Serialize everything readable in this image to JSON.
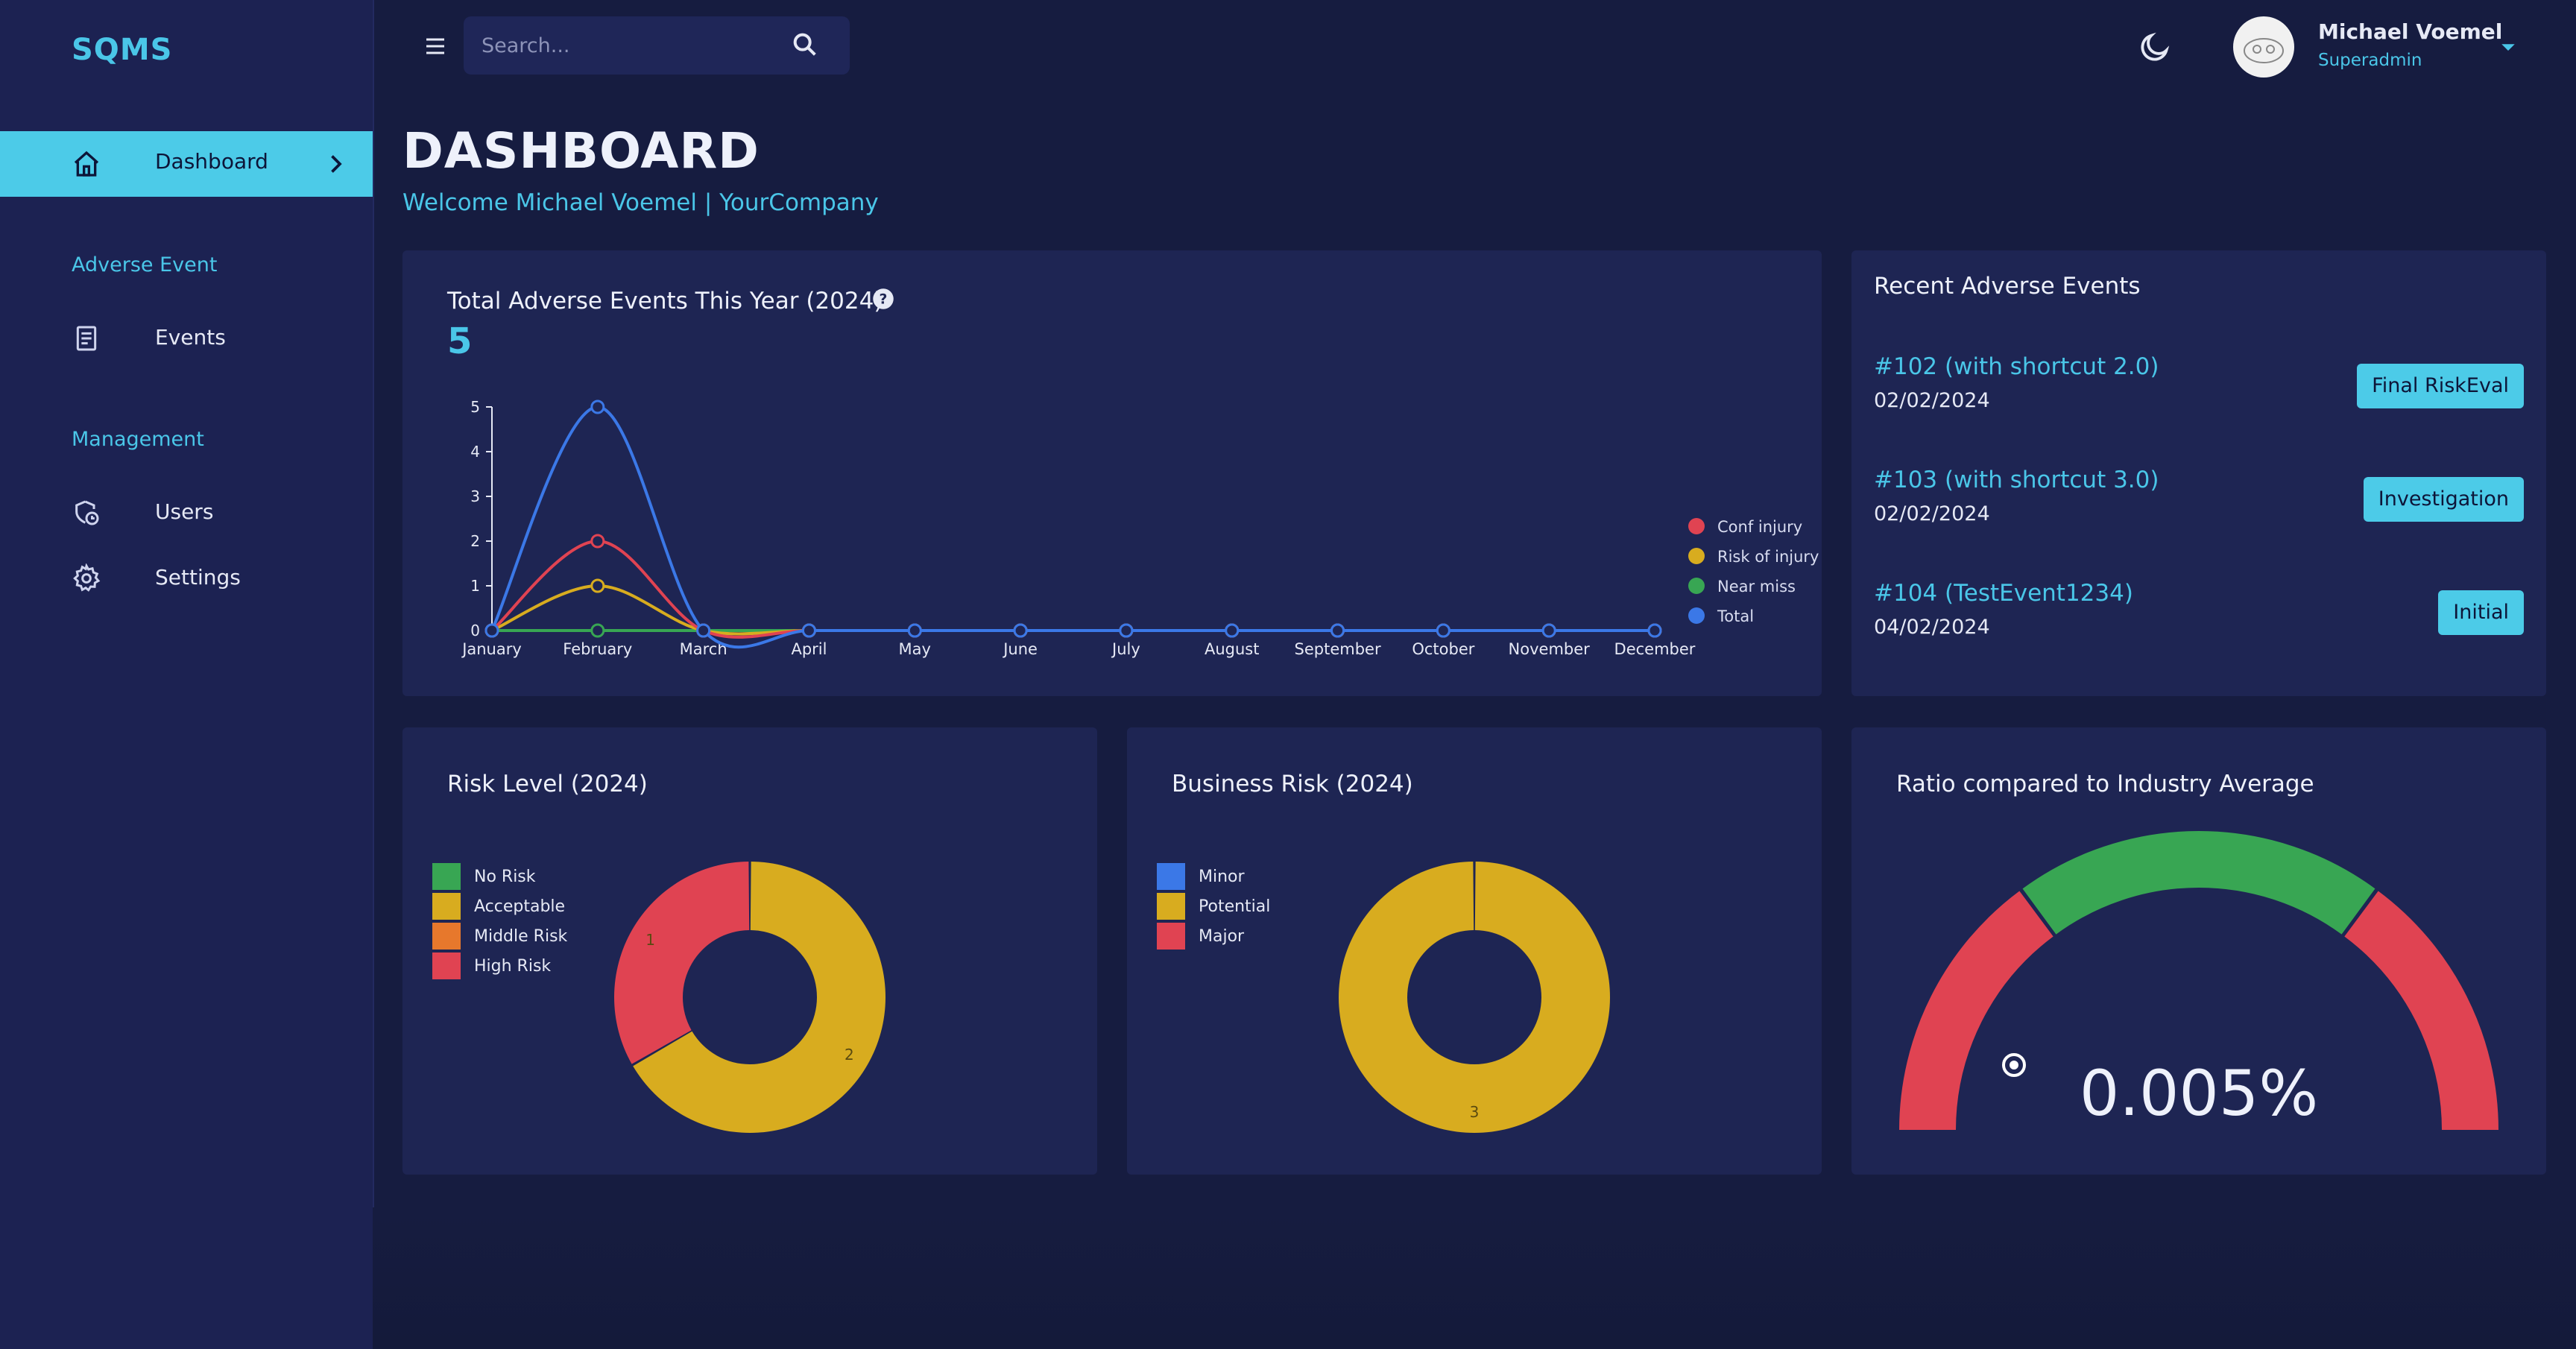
{
  "app": {
    "brand": "SQMS"
  },
  "sidebar": {
    "active_item": {
      "label": "Dashboard",
      "icon": "home-icon"
    },
    "sections": [
      {
        "title": "Adverse Event",
        "items": [
          {
            "label": "Events",
            "icon": "document-icon"
          }
        ]
      },
      {
        "title": "Management",
        "items": [
          {
            "label": "Users",
            "icon": "users-shield-icon"
          },
          {
            "label": "Settings",
            "icon": "gear-icon"
          }
        ]
      }
    ]
  },
  "topbar": {
    "search_placeholder": "Search...",
    "user": {
      "name": "Michael Voemel",
      "role": "Superadmin"
    }
  },
  "page": {
    "title": "DASHBOARD",
    "welcome": "Welcome Michael Voemel | YourCompany"
  },
  "total_events": {
    "title": "Total Adverse Events This Year (2024)",
    "value": "5"
  },
  "recent_events": {
    "title": "Recent Adverse Events",
    "items": [
      {
        "id": "#102 (with shortcut 2.0)",
        "date": "02/02/2024",
        "status": "Final RiskEval"
      },
      {
        "id": "#103 (with shortcut 3.0)",
        "date": "02/02/2024",
        "status": "Investigation"
      },
      {
        "id": "#104 (TestEvent1234)",
        "date": "04/02/2024",
        "status": "Initial"
      }
    ]
  },
  "risk_level": {
    "title": "Risk Level (2024)"
  },
  "business_risk": {
    "title": "Business Risk (2024)"
  },
  "gauge": {
    "title": "Ratio compared to Industry Average",
    "value_text": "0.005%",
    "value": 0.005
  },
  "colors": {
    "accent": "#4ccbe8",
    "green": "#38a653",
    "yellow": "#d8ac1f",
    "orange": "#e7782c",
    "red": "#e04352",
    "blue": "#3b78e7"
  },
  "chart_data": [
    {
      "type": "line",
      "x": [
        "January",
        "February",
        "March",
        "April",
        "May",
        "June",
        "July",
        "August",
        "September",
        "October",
        "November",
        "December"
      ],
      "ylim": [
        0,
        5
      ],
      "yticks": [
        "0",
        "1",
        "2",
        "3",
        "4",
        "5"
      ],
      "series": [
        {
          "name": "Conf injury",
          "color": "#e04352",
          "values": [
            0,
            2,
            0,
            0,
            0,
            0,
            0,
            0,
            0,
            0,
            0,
            0
          ]
        },
        {
          "name": "Risk of injury",
          "color": "#d8ac1f",
          "values": [
            0,
            1,
            0,
            0,
            0,
            0,
            0,
            0,
            0,
            0,
            0,
            0
          ]
        },
        {
          "name": "Near miss",
          "color": "#38a653",
          "values": [
            0,
            0,
            0,
            0,
            0,
            0,
            0,
            0,
            0,
            0,
            0,
            0
          ]
        },
        {
          "name": "Total",
          "color": "#3b78e7",
          "values": [
            0,
            5,
            0,
            0,
            0,
            0,
            0,
            0,
            0,
            0,
            0,
            0
          ]
        }
      ],
      "legend": "right"
    },
    {
      "type": "pie",
      "categories": [
        "No Risk",
        "Acceptable",
        "Middle Risk",
        "High Risk"
      ],
      "colors": [
        "#38a653",
        "#d8ac1f",
        "#e7782c",
        "#e04352"
      ],
      "values": [
        0,
        2,
        0,
        1
      ],
      "labels": [
        "",
        "2",
        "",
        "1"
      ],
      "legend": "left"
    },
    {
      "type": "pie",
      "categories": [
        "Minor",
        "Potential",
        "Major"
      ],
      "colors": [
        "#3b78e7",
        "#d8ac1f",
        "#e04352"
      ],
      "values": [
        0,
        3,
        0
      ],
      "labels": [
        "",
        "3",
        ""
      ],
      "legend": "left"
    }
  ]
}
